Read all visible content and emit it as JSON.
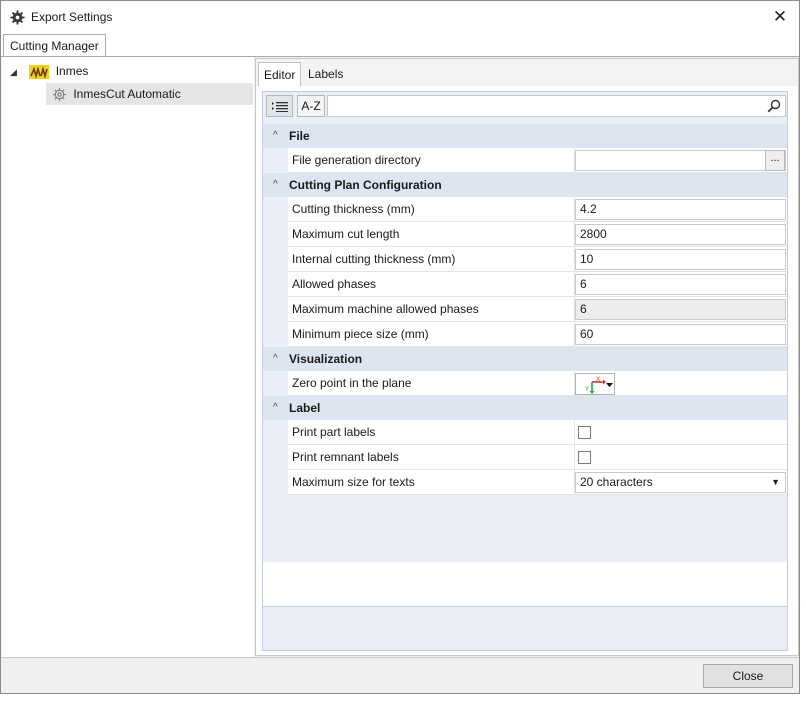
{
  "window": {
    "title": "Export Settings",
    "close_glyph": "✕",
    "icon": "gear-icon"
  },
  "outer_tabs": [
    {
      "label": "Cutting Manager",
      "active": true
    }
  ],
  "tree": {
    "root": {
      "label": "Inmes",
      "expander": "◢",
      "icon": "inmes-logo-icon"
    },
    "child": {
      "label": "InmesCut Automatic",
      "icon": "gear-icon",
      "selected": true
    }
  },
  "inner_tabs": [
    {
      "label": "Editor",
      "active": true
    },
    {
      "label": "Labels",
      "active": false
    }
  ],
  "toolbar": {
    "categorized_icon": "categorized-list-icon",
    "alphabetical_label": "A-Z",
    "search_value": "",
    "search_icon": "search-icon"
  },
  "categories": [
    {
      "label": "File",
      "properties": [
        {
          "label": "File generation directory",
          "value": "",
          "browse": "..."
        }
      ]
    },
    {
      "label": "Cutting Plan Configuration",
      "properties": [
        {
          "label": "Cutting thickness (mm)",
          "value": "4.2"
        },
        {
          "label": "Maximum cut length",
          "value": "2800"
        },
        {
          "label": "Internal cutting thickness (mm)",
          "value": "10"
        },
        {
          "label": "Allowed phases",
          "value": "6"
        },
        {
          "label": "Maximum machine allowed phases",
          "value": "6",
          "disabled": true
        },
        {
          "label": "Minimum piece size (mm)",
          "value": "60"
        }
      ]
    },
    {
      "label": "Visualization",
      "properties": [
        {
          "label": "Zero point in the plane",
          "icon": "axis-origin-icon",
          "axis_x": "X",
          "axis_y": "Y"
        }
      ]
    },
    {
      "label": "Label",
      "properties": [
        {
          "label": "Print part labels",
          "checked": false
        },
        {
          "label": "Print remnant labels",
          "checked": false
        },
        {
          "label": "Maximum size for texts",
          "value": "20 characters"
        }
      ]
    }
  ],
  "chevron": "^",
  "footer": {
    "close_label": "Close"
  },
  "colors": {
    "category_bg": "#dde5f1",
    "selected_tree_bg": "#e5e5e5",
    "axis_red": "#d9342b",
    "axis_green": "#27a33a"
  }
}
